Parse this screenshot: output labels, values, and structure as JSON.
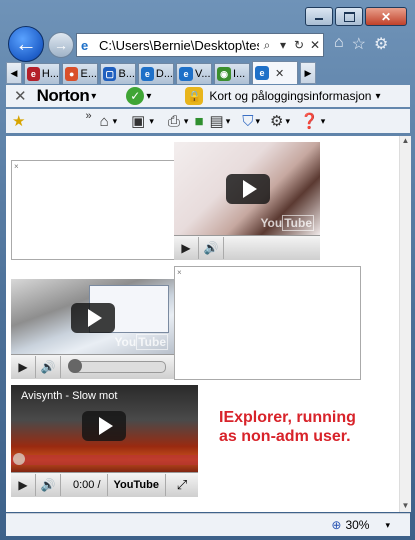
{
  "browser": {
    "address_url": "C:\\Users\\Bernie\\Desktop\\tes",
    "tabs": [
      {
        "label": "H...",
        "color": "#b4202a"
      },
      {
        "label": "E...",
        "color": "#d94f2a"
      },
      {
        "label": "B...",
        "color": "#1f5fbf"
      },
      {
        "label": "D...",
        "color": "#1e70c8"
      },
      {
        "label": "V...",
        "color": "#1e70c8"
      },
      {
        "label": "I...",
        "color": "#3b8f2d"
      },
      {
        "label": "",
        "color": "#1e70c8"
      }
    ],
    "norton_label": "Norton",
    "norton_caret": "·",
    "kort_label": "Kort og påloggingsinformasjon",
    "zoom": "30%"
  },
  "content": {
    "video1": {
      "time": ""
    },
    "video4": {
      "title": "Avisynth - Slow mot",
      "time": "0:00 /",
      "yt_label": "YouTube"
    },
    "note_line1": "IExplorer, running",
    "note_line2": "as non-adm user."
  }
}
